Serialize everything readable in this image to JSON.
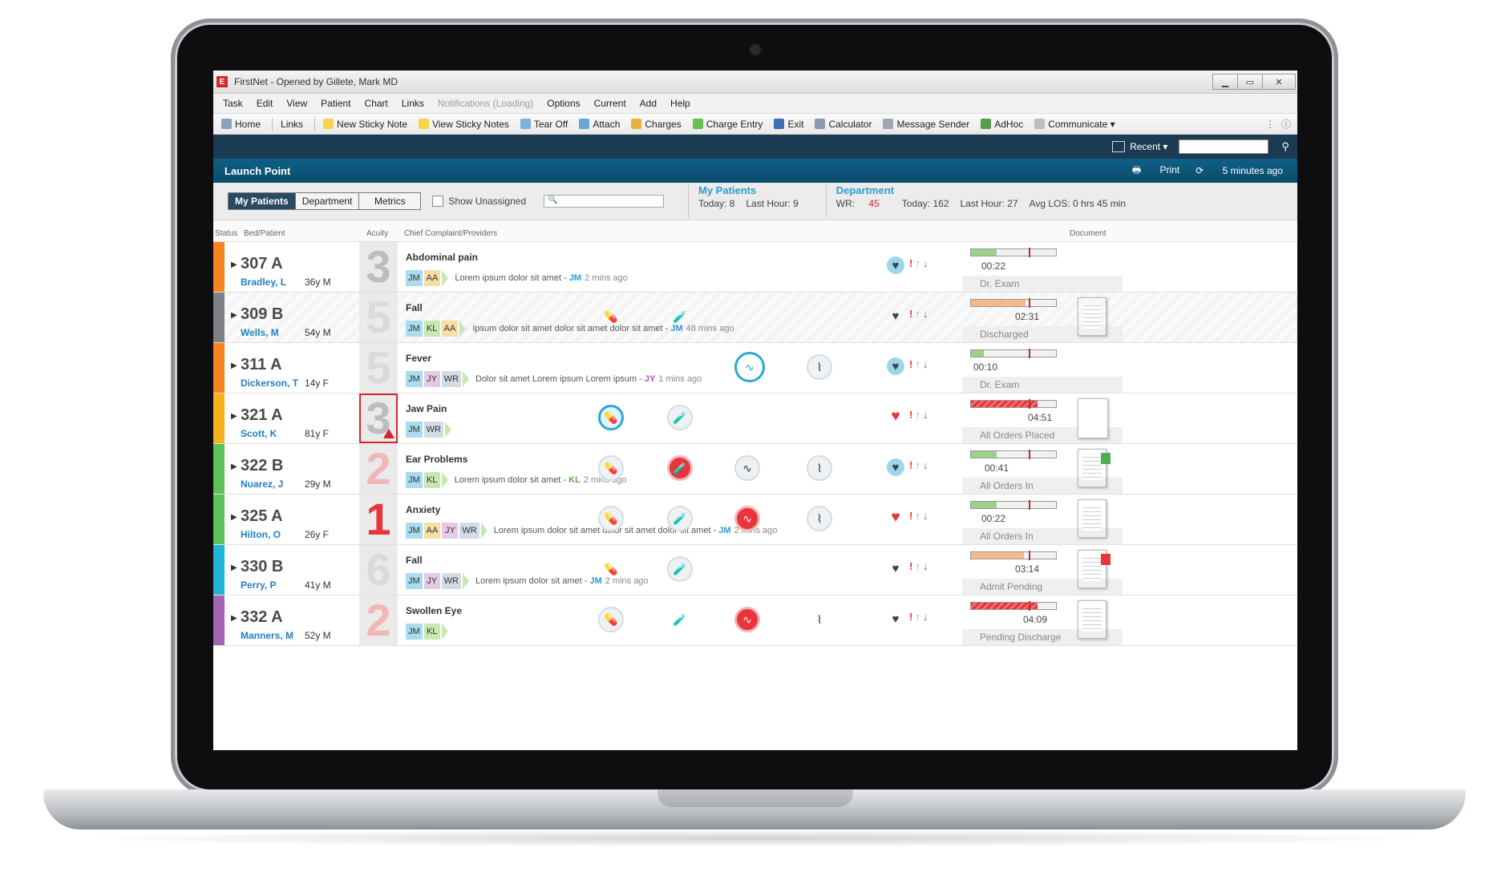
{
  "window": {
    "title": "FirstNet - Opened by Gillete, Mark MD",
    "app_icon": "E",
    "min": "▁",
    "max": "▭",
    "close": "✕"
  },
  "menu": [
    "Task",
    "Edit",
    "View",
    "Patient",
    "Chart",
    "Links",
    "Notifications (Loading)",
    "Options",
    "Current",
    "Add",
    "Help"
  ],
  "toolbar": {
    "home": "Home",
    "links": "Links",
    "new_sticky": "New Sticky Note",
    "view_sticky": "View Sticky Notes",
    "tear_off": "Tear Off",
    "attach": "Attach",
    "charges": "Charges",
    "charge_entry": "Charge Entry",
    "exit": "Exit",
    "calculator": "Calculator",
    "message_sender": "Message Sender",
    "adhoc": "AdHoc",
    "communicate": "Communicate ▾"
  },
  "nav": {
    "recent": "Recent ▾",
    "search_icon": "⚲"
  },
  "launch": {
    "title": "Launch Point",
    "print": "Print",
    "updated": "5 minutes ago"
  },
  "filters": {
    "tabs": [
      "My Patients",
      "Department",
      "Metrics"
    ],
    "show_unassigned": "Show Unassigned",
    "search_icon": "🔍"
  },
  "stats": {
    "my": {
      "title": "My Patients",
      "today": "Today: 8",
      "last_hour": "Last Hour: 9"
    },
    "dept": {
      "title": "Department",
      "wr_label": "WR: ",
      "wr_value": "45",
      "today": "Today: 162",
      "last_hour": "Last Hour: 27",
      "avg_los": "Avg LOS: 0 hrs 45 min"
    }
  },
  "columns": {
    "status": "Status",
    "bed": "Bed/Patient",
    "acuity": "Acuity",
    "chief": "Chief Complaint/Providers",
    "document": "Document"
  },
  "colors": {
    "accent": "#2d9bd1",
    "nav": "#1b3b53",
    "launch": "#0e5f86",
    "alert": "#e8343a"
  },
  "patients": [
    {
      "bed": "307 A",
      "name": "Bradley, L",
      "age": "36y M",
      "acuity": "3",
      "complaint": "Abdominal pain",
      "providers": [
        "JM",
        "AA"
      ],
      "note": "Lorem ipsum dolor sit amet -",
      "note_by": "JM",
      "note_ago": "2 mins ago",
      "time": "00:22",
      "status": "Dr. Exam"
    },
    {
      "bed": "309 B",
      "name": "Wells, M",
      "age": "54y M",
      "acuity": "5",
      "complaint": "Fall",
      "providers": [
        "JM",
        "KL",
        "AA"
      ],
      "note": "Ipsum dolor sit amet dolor sit amet dolor sit amet -",
      "note_by": "JM",
      "note_ago": "48 mins ago",
      "time": "02:31",
      "status": "Discharged"
    },
    {
      "bed": "311 A",
      "name": "Dickerson, T",
      "age": "14y F",
      "acuity": "5",
      "complaint": "Fever",
      "providers": [
        "JM",
        "JY",
        "WR"
      ],
      "note": "Dolor sit amet Lorem ipsum Lorem ipsum -",
      "note_by": "JY",
      "note_ago": "1 mins ago",
      "time": "00:10",
      "status": "Dr. Exam"
    },
    {
      "bed": "321 A",
      "name": "Scott, K",
      "age": "81y F",
      "acuity": "3",
      "complaint": "Jaw Pain",
      "providers": [
        "JM",
        "WR"
      ],
      "note": "",
      "note_by": "",
      "note_ago": "",
      "time": "04:51",
      "status": "All Orders Placed"
    },
    {
      "bed": "322 B",
      "name": "Nuarez, J",
      "age": "29y M",
      "acuity": "2",
      "complaint": "Ear Problems",
      "providers": [
        "JM",
        "KL"
      ],
      "note": "Lorem ipsum dolor sit amet -",
      "note_by": "KL",
      "note_ago": "2 mins ago",
      "time": "00:41",
      "status": "All Orders In"
    },
    {
      "bed": "325 A",
      "name": "Hilton, O",
      "age": "26y F",
      "acuity": "1",
      "complaint": "Anxiety",
      "providers": [
        "JM",
        "AA",
        "JY",
        "WR"
      ],
      "note": "Lorem ipsum dolor sit amet dolor sit amet dolor sit amet -",
      "note_by": "JM",
      "note_ago": "2 mins ago",
      "time": "00:22",
      "status": "All Orders In"
    },
    {
      "bed": "330 B",
      "name": "Perry, P",
      "age": "41y M",
      "acuity": "6",
      "complaint": "Fall",
      "providers": [
        "JM",
        "JY",
        "WR"
      ],
      "note": "Lorem ipsum dolor sit amet -",
      "note_by": "JM",
      "note_ago": "2 mins ago",
      "time": "03:14",
      "status": "Admit Pending"
    },
    {
      "bed": "332 A",
      "name": "Manners, M",
      "age": "52y M",
      "acuity": "2",
      "complaint": "Swollen Eye",
      "providers": [
        "JM",
        "KL"
      ],
      "note": "",
      "note_by": "",
      "note_ago": "",
      "time": "04:09",
      "status": "Pending Discharge"
    }
  ],
  "row_icons": {
    "pill": "pill-icon",
    "vial": "vial-icon",
    "ecg": "ecg-icon",
    "xray": "xray-icon"
  },
  "glyphs": {
    "pill": "💊",
    "vial": "🧪",
    "ecg": "∿",
    "xray": "⌇",
    "heart": "♥",
    "excl": "!",
    "up": "↑",
    "down": "↓",
    "expand": "▶"
  }
}
